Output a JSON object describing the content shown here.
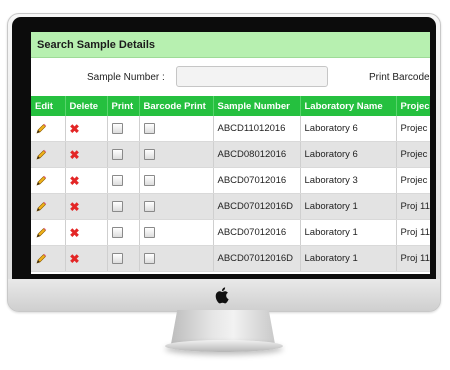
{
  "panel": {
    "title": "Search Sample Details"
  },
  "search": {
    "sample_number_label": "Sample Number :",
    "sample_number_value": "",
    "print_barcode_label": "Print Barcode"
  },
  "table": {
    "headers": [
      "Edit",
      "Delete",
      "Print",
      "Barcode Print",
      "Sample Number",
      "Laboratory Name",
      "Projec"
    ],
    "rows": [
      {
        "sample_number": "ABCD11012016",
        "laboratory": "Laboratory 6",
        "project": "Projec"
      },
      {
        "sample_number": "ABCD08012016",
        "laboratory": "Laboratory 6",
        "project": "Projec"
      },
      {
        "sample_number": "ABCD07012016",
        "laboratory": "Laboratory 3",
        "project": "Projec"
      },
      {
        "sample_number": "ABCD07012016D",
        "laboratory": "Laboratory 1",
        "project": "Proj 11"
      },
      {
        "sample_number": "ABCD07012016",
        "laboratory": "Laboratory 1",
        "project": "Proj 11"
      },
      {
        "sample_number": "ABCD07012016D",
        "laboratory": "Laboratory 1",
        "project": "Proj 11"
      }
    ]
  },
  "icons": {
    "edit": "pencil-icon",
    "delete": "delete-x-icon",
    "device": "apple-logo-icon"
  },
  "colors": {
    "header_green": "#25c03f",
    "title_green": "#b7f0b0",
    "delete_red": "#e32626"
  }
}
